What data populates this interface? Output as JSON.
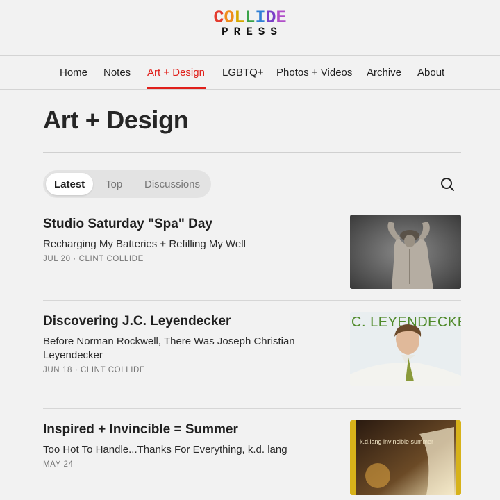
{
  "brand": {
    "logo_top": [
      "C",
      "O",
      "L",
      "L",
      "I",
      "D",
      "E"
    ],
    "logo_top_colors": [
      "#e33b2e",
      "#f08c1b",
      "#e0b400",
      "#3aa34a",
      "#2f7fd6",
      "#7a3fc7",
      "#b14fc9"
    ],
    "logo_bottom": "PRESS"
  },
  "nav": {
    "items": [
      "Home",
      "Notes",
      "Art + Design",
      "LGBTQ+",
      "Photos + Videos",
      "Archive",
      "About"
    ],
    "active": "Art + Design",
    "accent": "#e0201b"
  },
  "page": {
    "title": "Art + Design"
  },
  "tabs": {
    "items": [
      "Latest",
      "Top",
      "Discussions"
    ],
    "active": "Latest"
  },
  "search": {
    "icon": "search-icon"
  },
  "posts": [
    {
      "title": "Studio Saturday \"Spa\" Day",
      "subtitle": "Recharging My Batteries + Refilling My Well",
      "meta": "JUL 20 · CLINT COLLIDE"
    },
    {
      "title": "Discovering J.C. Leyendecker",
      "subtitle": "Before Norman Rockwell, There Was Joseph Christian Leyendecker",
      "meta": "JUN 18 · CLINT COLLIDE",
      "thumb_text": ".C. LEYENDECKE"
    },
    {
      "title": "Inspired + Invincible = Summer",
      "subtitle": "Too Hot To Handle...Thanks For Everything, k.d. lang",
      "meta": "MAY 24",
      "thumb_text": "k.d.lang invincible summer"
    }
  ]
}
